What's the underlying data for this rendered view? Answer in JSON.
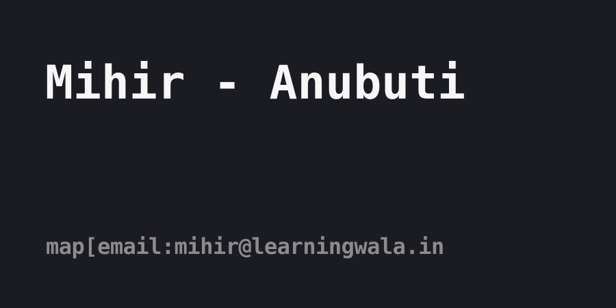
{
  "card": {
    "title": "Mihir - Anubuti",
    "subtitle": "map[email:mihir@learningwala.in"
  },
  "colors": {
    "background": "#1b1b22",
    "title": "#f7f7f8",
    "subtitle": "#8c8c8f"
  }
}
